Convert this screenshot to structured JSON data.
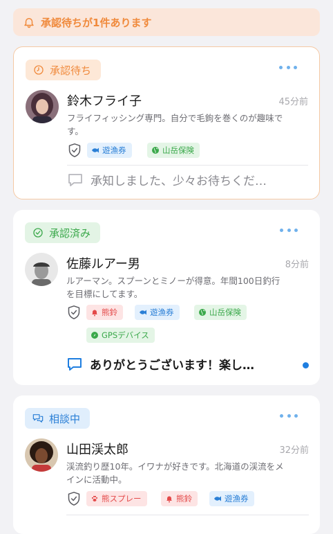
{
  "banner": {
    "text": "承認待ちが1件あります",
    "icon": "bell-icon",
    "color": "#f08a3c"
  },
  "cards": [
    {
      "status": "承認待ち",
      "status_icon": "clock-icon",
      "name": "鈴木フライ子",
      "time": "45分前",
      "bio": "フライフィッシング専門。自分で毛鉤を巻くのが趣味です。",
      "tags": [
        {
          "label": "遊漁券",
          "icon": "fish-icon",
          "color": "blue"
        },
        {
          "label": "山岳保険",
          "icon": "globe-icon",
          "color": "green"
        }
      ],
      "message": "承知しました、少々お待ちくだ…",
      "message_unread": false
    },
    {
      "status": "承認済み",
      "status_icon": "check-circle-icon",
      "name": "佐藤ルアー男",
      "time": "8分前",
      "bio": "ルアーマン。スプーンとミノーが得意。年間100日釣行を目標にしてます。",
      "tags": [
        {
          "label": "熊鈴",
          "icon": "bell-icon",
          "color": "red"
        },
        {
          "label": "遊漁券",
          "icon": "fish-icon",
          "color": "blue"
        },
        {
          "label": "山岳保険",
          "icon": "globe-icon",
          "color": "green"
        },
        {
          "label": "GPSデバイス",
          "icon": "compass-icon",
          "color": "green"
        }
      ],
      "message": "ありがとうございます！楽し…",
      "message_unread": true
    },
    {
      "status": "相談中",
      "status_icon": "chat-bubbles-icon",
      "name": "山田渓太郎",
      "time": "32分前",
      "bio": "渓流釣り歴10年。イワナが好きです。北海道の渓流をメインに活動中。",
      "tags": [
        {
          "label": "熊スプレー",
          "icon": "paw-icon",
          "color": "red"
        },
        {
          "label": "熊鈴",
          "icon": "bell-icon",
          "color": "red"
        },
        {
          "label": "遊漁券",
          "icon": "fish-icon",
          "color": "blue"
        }
      ]
    }
  ]
}
